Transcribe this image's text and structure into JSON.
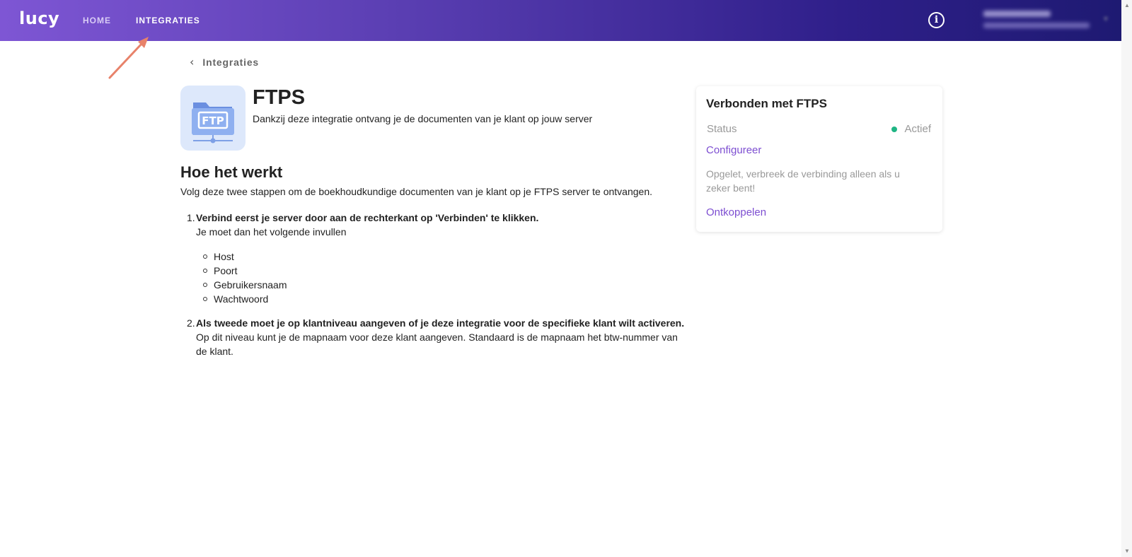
{
  "header": {
    "logo": "lucy",
    "nav": [
      {
        "label": "HOME"
      },
      {
        "label": "INTEGRATIES"
      }
    ],
    "info_icon": "info-circle-icon",
    "colors": {
      "gradient_start": "#7e56d4",
      "gradient_end": "#1e1a72"
    }
  },
  "breadcrumb": {
    "back_label": "Integraties",
    "icon": "chevron-left-icon"
  },
  "integration": {
    "title": "FTPS",
    "description": "Dankzij deze integratie ontvang je de documenten van je klant op jouw server",
    "icon": "ftp-folder-icon",
    "icon_text": "FTP"
  },
  "how": {
    "title": "Hoe het werkt",
    "subtitle": "Volg deze twee stappen om de boekhoudkundige documenten van je klant op je FTPS server te ontvangen.",
    "steps": [
      {
        "number": "1.",
        "title": "Verbind eerst je server door aan de rechterkant op 'Verbinden' te klikken.",
        "text": "Je moet dan het volgende invullen",
        "bullets": [
          "Host",
          "Poort",
          "Gebruikersnaam",
          "Wachtwoord"
        ]
      },
      {
        "number": "2.",
        "title": "Als tweede moet je op klantniveau aangeven of je deze integratie voor de specifieke klant wilt activeren.",
        "text": "Op dit niveau kunt je de mapnaam voor deze klant aangeven. Standaard is de mapnaam het btw-nummer van de klant."
      }
    ]
  },
  "card": {
    "title": "Verbonden met FTPS",
    "status_label": "Status",
    "status_value": "Actief",
    "status_color": "#1fb584",
    "configure_label": "Configureer",
    "warning": "Opgelet, verbreek de verbinding alleen als u zeker bent!",
    "disconnect_label": "Ontkoppelen",
    "link_color": "#7d4ed1"
  }
}
